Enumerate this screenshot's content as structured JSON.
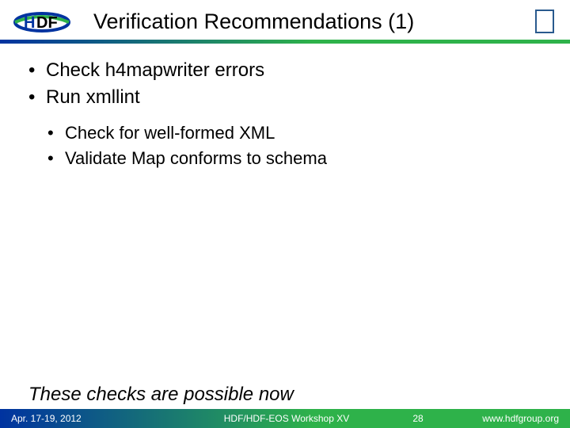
{
  "header": {
    "title": "Verification Recommendations (1)",
    "logo_text_h": "H",
    "logo_text_df": "DF"
  },
  "body": {
    "bullets": [
      "Check h4mapwriter errors",
      "Run xmllint"
    ],
    "sub_bullets": [
      "Check for well-formed XML",
      "Validate Map conforms to schema"
    ],
    "callout": "These checks are possible now"
  },
  "footer": {
    "date": "Apr. 17-19, 2012",
    "event": "HDF/HDF-EOS Workshop XV",
    "page": "28",
    "url": "www.hdfgroup.org"
  }
}
